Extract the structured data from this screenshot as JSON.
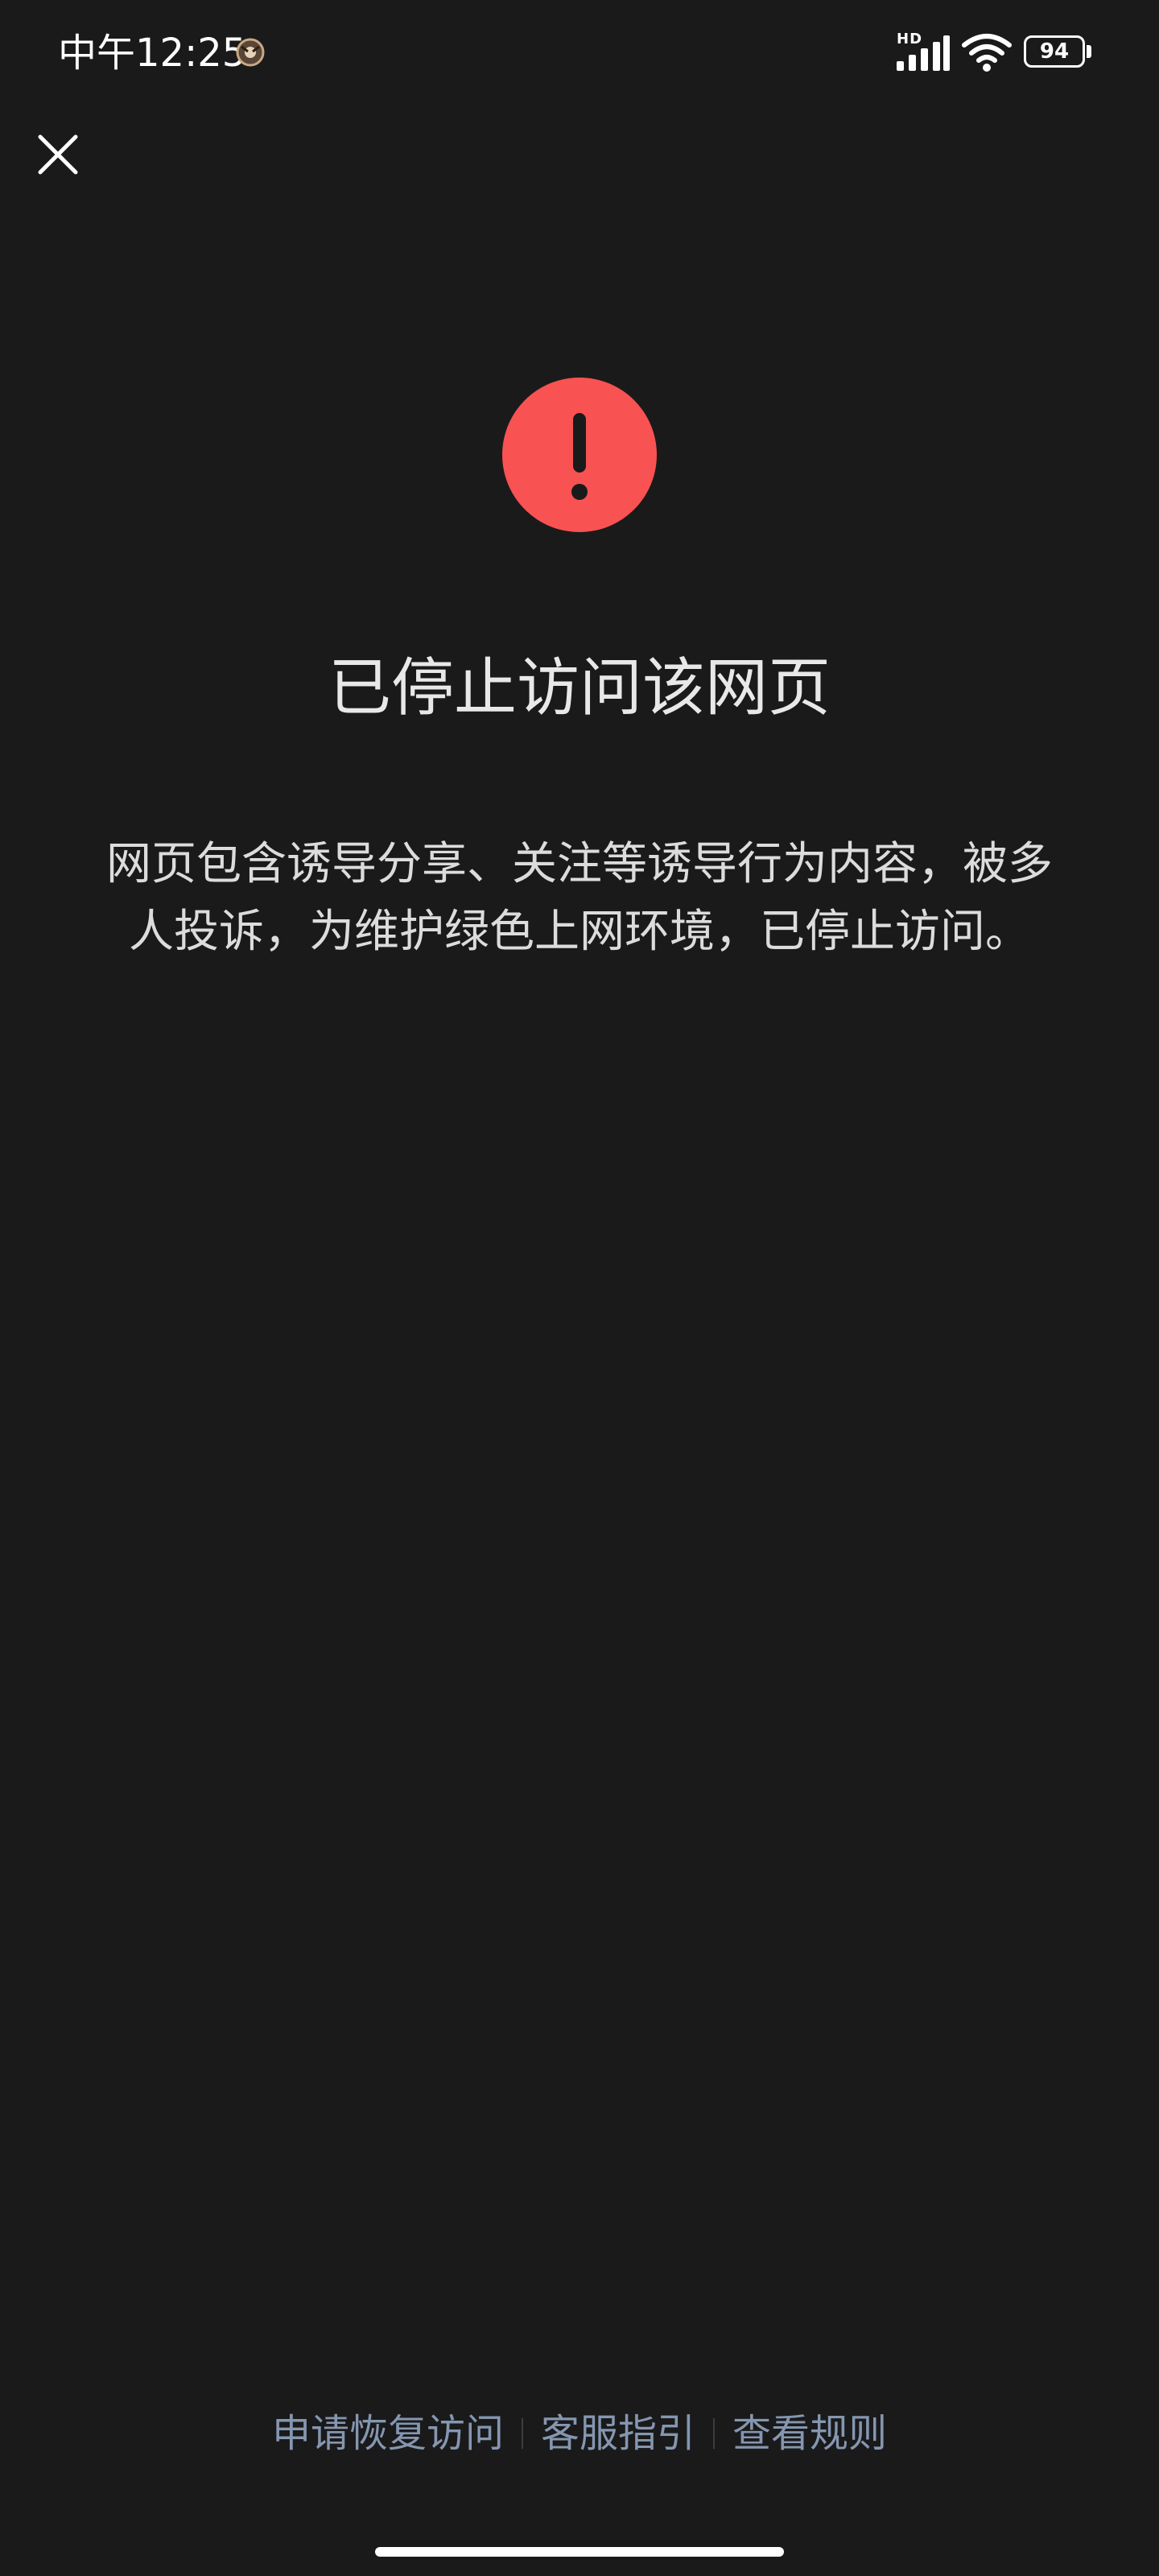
{
  "status_bar": {
    "time": "中午12:25",
    "network_badge": "HD",
    "battery_level": "94",
    "battery_percent": 94,
    "icons": [
      "app-notification-icon",
      "signal-icon",
      "wifi-icon",
      "battery-icon"
    ]
  },
  "header": {
    "close_icon": "close-icon"
  },
  "content": {
    "alert_icon": "exclamation-circle-icon",
    "alert_color": "#f95252",
    "title": "已停止访问该网页",
    "message": "网页包含诱导分享、关注等诱导行为内容，被多人投诉，为维护绿色上网环境，已停止访问。"
  },
  "footer": {
    "links": [
      "申请恢复访问",
      "客服指引",
      "查看规则"
    ],
    "link_color": "#8596b0"
  },
  "colors": {
    "background": "#1a1a1b",
    "text": "#e6e6e6"
  }
}
